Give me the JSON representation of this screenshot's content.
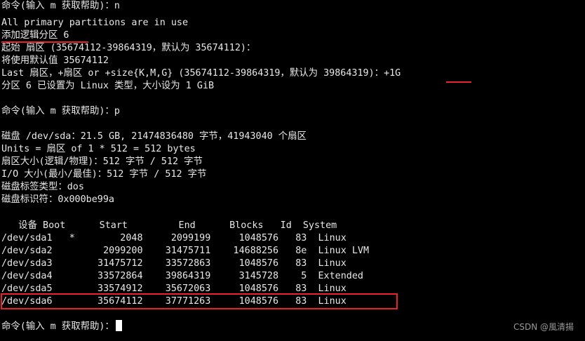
{
  "terminal": {
    "lines": [
      "命令(输入 m 获取帮助)：n",
      "All primary partitions are in use",
      "添加逻辑分区 6",
      "起始 扇区 (35674112-39864319，默认为 35674112)：",
      "将使用默认值 35674112",
      "Last 扇区，+扇区 or +size{K,M,G} (35674112-39864319，默认为 39864319)：",
      "分区 6 已设置为 Linux 类型，大小设为 1 GiB",
      "",
      "命令(输入 m 获取帮助)：p",
      "",
      "磁盘 /dev/sda：21.5 GB, 21474836480 字节，41943040 个扇区",
      "Units = 扇区 of 1 * 512 = 512 bytes",
      "扇区大小(逻辑/物理)：512 字节 / 512 字节",
      "I/O 大小(最小/最佳)：512 字节 / 512 字节",
      "磁盘标签类型：dos",
      "磁盘标识符：0x000be99a"
    ],
    "size_input": "+1G",
    "table_header": "   设备 Boot      Start         End      Blocks   Id  System",
    "table_rows": [
      "/dev/sda1   *        2048     2099199     1048576   83  Linux",
      "/dev/sda2         2099200    31475711    14688256   8e  Linux LVM",
      "/dev/sda3        31475712    33572863     1048576   83  Linux",
      "/dev/sda4        33572864    39864319     3145728    5  Extended",
      "/dev/sda5        33574912    35672063     1048576   83  Linux",
      "/dev/sda6        35674112    37771263     1048576   83  Linux"
    ],
    "final_prompt": "命令(输入 m 获取帮助)："
  },
  "watermark": "CSDN @風清揚",
  "colors": {
    "background": "#000000",
    "text": "#e8e8e8",
    "highlight": "#e8232a"
  }
}
